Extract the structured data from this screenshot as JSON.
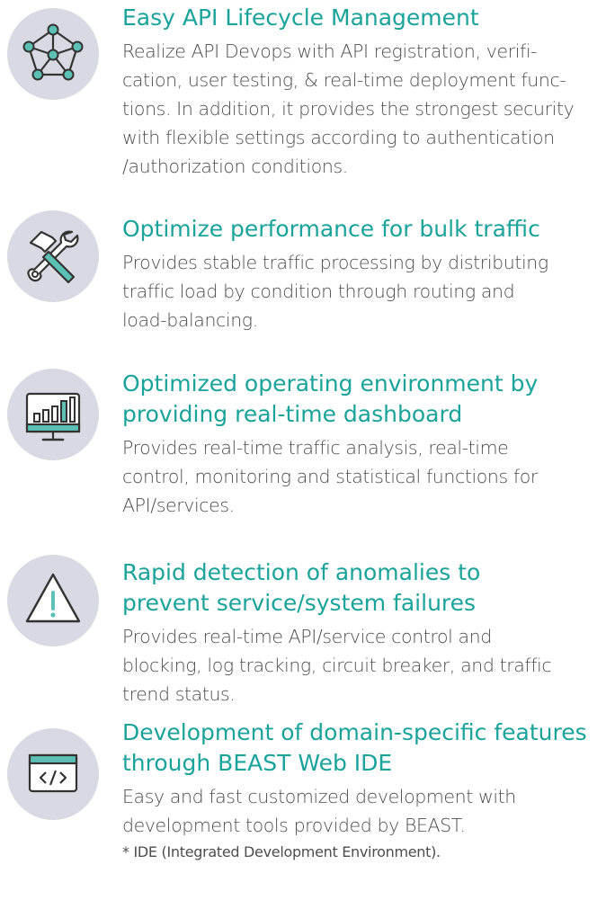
{
  "colors": {
    "title": "#1aa39a",
    "text": "#4d4d4d",
    "icon_bg": "#d8d9e2",
    "icon_accent": "#5cc0b5",
    "icon_stroke": "#333333"
  },
  "features": [
    {
      "icon": "network-nodes-icon",
      "title": "Easy API Lifecycle Management",
      "lines": [
        "Realize API Devops with API registration, verifi-",
        "cation, user testing, & real-time deployment func-",
        "tions. In addition, it provides the strongest security",
        "with flexible settings according to authentication",
        "/authorization conditions."
      ]
    },
    {
      "icon": "hammer-wrench-icon",
      "title": "Optimize performance for bulk traffic",
      "lines": [
        "Provides stable traffic processing by distributing",
        "traffic load by condition through routing and",
        "load-balancing."
      ]
    },
    {
      "icon": "dashboard-monitor-icon",
      "title_lines": [
        "Optimized operating environment by",
        "providing real-time dashboard"
      ],
      "lines": [
        "Provides real-time traffic analysis, real-time",
        "control, monitoring and statistical functions for",
        "API/services."
      ]
    },
    {
      "icon": "warning-triangle-icon",
      "title_lines": [
        "Rapid detection of anomalies to",
        "prevent service/system failures"
      ],
      "lines": [
        "Provides real-time API/service control and",
        "blocking, log tracking, circuit breaker, and traffic",
        "trend status."
      ]
    },
    {
      "icon": "code-window-icon",
      "title_lines": [
        "Development of domain-specific features",
        "through BEAST Web IDE"
      ],
      "lines": [
        "Easy and fast customized development with",
        "development tools provided by BEAST."
      ],
      "note": "* IDE (Integrated Development Environment)."
    }
  ]
}
